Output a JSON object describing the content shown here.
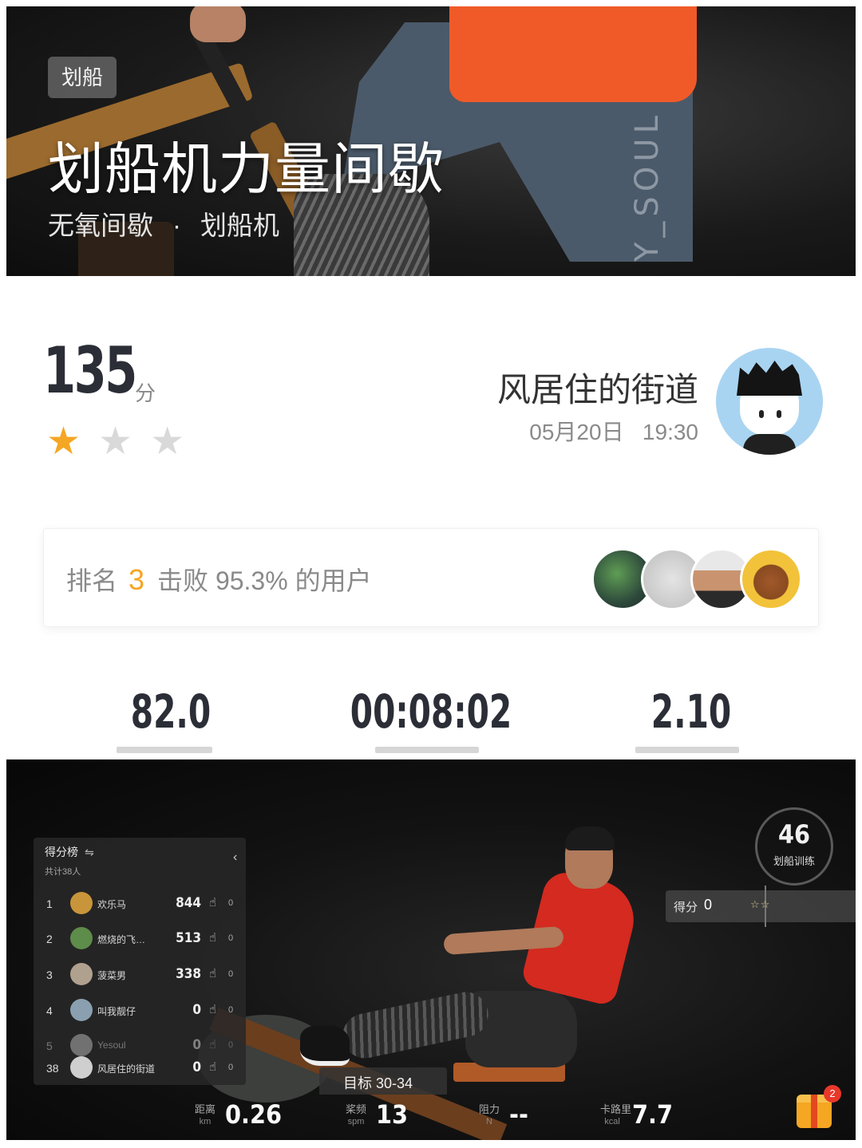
{
  "hero": {
    "tag": "划船",
    "title": "划船机力量间歇",
    "subtitle_type": "无氧间歇",
    "subtitle_sep": "·",
    "subtitle_equipment": "划船机",
    "brand_text": "Y_SOUL"
  },
  "result": {
    "score": "135",
    "score_unit": "分",
    "stars_total": 3,
    "stars_earned": 1,
    "star_colors": {
      "on": "#f5a623",
      "off": "#d9d9d9"
    },
    "user_name": "风居住的街道",
    "date": "05月20日",
    "time": "19:30"
  },
  "rank": {
    "label": "排名",
    "value": "3",
    "beat_text": "击败 95.3% 的用户",
    "accent": "#f5a623"
  },
  "stats": {
    "v1": "82.0",
    "v2": "00:08:02",
    "v3": "2.10"
  },
  "video": {
    "leaderboard": {
      "title": "得分榜",
      "swap_icon": "⇋",
      "count": "共计38人",
      "collapse_icon": "‹",
      "rows": [
        {
          "rank": "1",
          "name": "欢乐马",
          "score": "844",
          "likes": "0"
        },
        {
          "rank": "2",
          "name": "燃烧的飞…",
          "score": "513",
          "likes": "0"
        },
        {
          "rank": "3",
          "name": "菠菜男",
          "score": "338",
          "likes": "0"
        },
        {
          "rank": "4",
          "name": "叫我靓仔",
          "score": "0",
          "likes": "0"
        },
        {
          "rank": "5",
          "name": "Yesoul",
          "score": "0",
          "likes": "0"
        },
        {
          "rank": "38",
          "name": "风居住的街道",
          "score": "0",
          "likes": "0"
        }
      ]
    },
    "timer": {
      "value": "46",
      "label": "划船训练"
    },
    "scorebar": {
      "label": "得分",
      "value": "0",
      "stars": "☆☆"
    },
    "target": "目标 30-34",
    "metrics": [
      {
        "name": "距离",
        "unit": "km",
        "value": "0.26"
      },
      {
        "name": "桨频",
        "unit": "spm",
        "value": "13"
      },
      {
        "name": "阻力",
        "unit": "N",
        "value": "--"
      },
      {
        "name": "卡路里",
        "unit": "kcal",
        "value": "7.7"
      }
    ],
    "gift_badge": "2"
  }
}
